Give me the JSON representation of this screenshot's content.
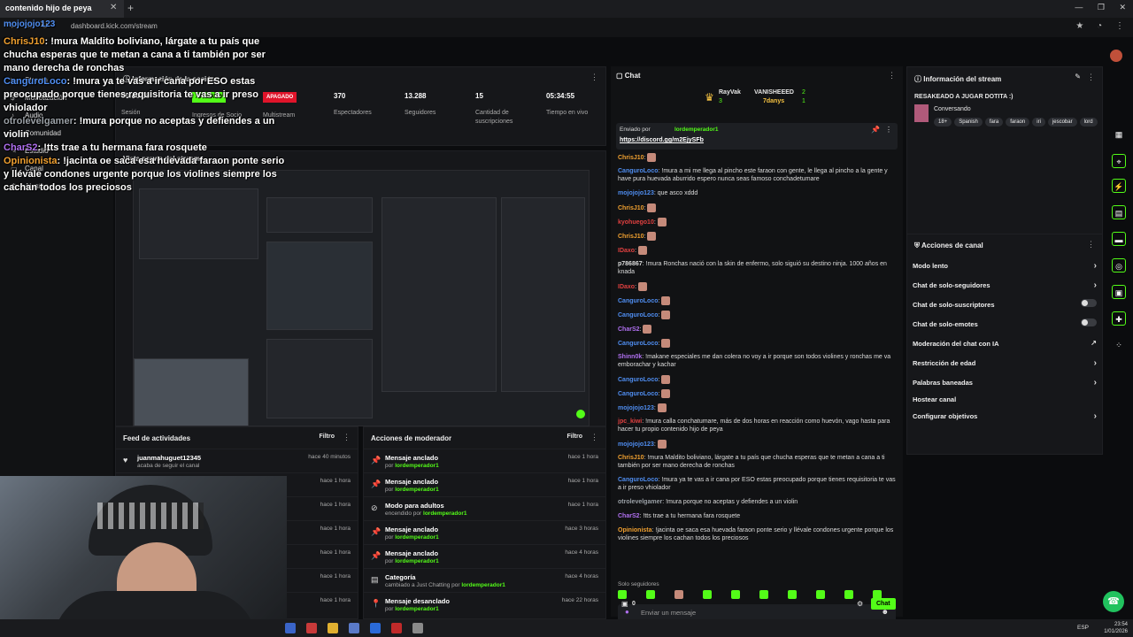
{
  "browser": {
    "tab_title": "contenido hijo de peya",
    "url": "dashboard.kick.com/stream"
  },
  "sidebar": {
    "items": [
      {
        "label": "Stream",
        "icon": "play-icon"
      },
      {
        "label": "Monetización",
        "icon": "coin-icon"
      },
      {
        "label": "Audio",
        "icon": "speaker-icon"
      },
      {
        "label": "Comunidad",
        "icon": "users-icon"
      },
      {
        "label": "Estudio",
        "icon": "brush-icon"
      },
      {
        "label": "Canal",
        "icon": "tv-icon"
      },
      {
        "label": "Ajustes",
        "icon": "gear-icon"
      }
    ]
  },
  "session": {
    "title": "Información de la sesión",
    "stats": [
      {
        "value": "00:00:00",
        "label": "Sesión"
      },
      {
        "value": "APAGADO",
        "label": "Ingresos de Socio"
      },
      {
        "value": "APAGADO",
        "label": "Multistream"
      },
      {
        "value": "370",
        "label": "Espectadores"
      },
      {
        "value": "13.288",
        "label": "Seguidores"
      },
      {
        "value": "15",
        "label": "Cantidad de suscripciones"
      },
      {
        "value": "05:34:55",
        "label": "Tiempo en vivo"
      }
    ]
  },
  "preview": {
    "title": "Vista previa del stream"
  },
  "activity": {
    "title": "Feed de actividades",
    "filter": "Filtro",
    "items": [
      {
        "user": "juanmahuguet12345",
        "desc": "acaba de seguir el canal",
        "time": "hace 40 minutos"
      },
      {
        "user": "",
        "desc": "",
        "time": "hace 1 hora"
      },
      {
        "user": "",
        "desc": "",
        "time": "hace 1 hora"
      },
      {
        "user": "",
        "desc": "",
        "time": "hace 1 hora"
      },
      {
        "user": "",
        "desc": "",
        "time": "hace 1 hora"
      },
      {
        "user": "",
        "desc": "",
        "time": "hace 1 hora"
      },
      {
        "user": "",
        "desc": "",
        "time": "hace 1 hora"
      }
    ]
  },
  "moderator": {
    "title": "Acciones de moderador",
    "filter": "Filtro",
    "items": [
      {
        "icon": "pin-icon",
        "title": "Mensaje anclado",
        "pre": "por",
        "by": "lordemperador1",
        "time": "hace 1 hora"
      },
      {
        "icon": "pin-icon",
        "title": "Mensaje anclado",
        "pre": "por",
        "by": "lordemperador1",
        "time": "hace 1 hora"
      },
      {
        "icon": "adult-icon",
        "title": "Modo para adultos",
        "pre": "encendido por",
        "by": "lordemperador1",
        "time": "hace 1 hora"
      },
      {
        "icon": "pin-icon",
        "title": "Mensaje anclado",
        "pre": "por",
        "by": "lordemperador1",
        "time": "hace 3 horas"
      },
      {
        "icon": "pin-icon",
        "title": "Mensaje anclado",
        "pre": "por",
        "by": "lordemperador1",
        "time": "hace 4 horas"
      },
      {
        "icon": "category-icon",
        "title": "Categoría",
        "pre": "cambiado a Just Chatting por",
        "by": "lordemperador1",
        "time": "hace 4 horas"
      },
      {
        "icon": "unpin-icon",
        "title": "Mensaje desanclado",
        "pre": "por",
        "by": "lordemperador1",
        "time": "hace 22 horas"
      }
    ]
  },
  "chat": {
    "title": "Chat",
    "top": [
      {
        "user": "RayVak",
        "count": "3",
        "color": "#f5c242"
      },
      {
        "user": "VANISHEEED",
        "count": "2",
        "color": "#ffffff"
      },
      {
        "user": "7danys",
        "count": "1",
        "color": "#f5c242"
      }
    ],
    "pinned_by_label": "Enviado por",
    "pinned_by": "lordemperador1",
    "pinned_link": "https://discord.gg/m2EjySFb",
    "messages": [
      {
        "user": "ChrisJ10",
        "color": "#f0a030",
        "text": ""
      },
      {
        "user": "CanguroLoco",
        "color": "#4f8df0",
        "text": "!mura a mi me llega al pincho este faraon con gente, le llega al pincho a la gente y have pura huevada aburrido espero nunca seas famoso conchadetumare"
      },
      {
        "user": "mojojojo123",
        "color": "#4f8df0",
        "text": "que asco xddd"
      },
      {
        "user": "ChrisJ10",
        "color": "#f0a030",
        "text": ""
      },
      {
        "user": "kyohuego10",
        "color": "#e04040",
        "text": ""
      },
      {
        "user": "ChrisJ10",
        "color": "#f0a030",
        "text": ""
      },
      {
        "user": "IDaxo",
        "color": "#e04040",
        "text": ""
      },
      {
        "user": "p786867",
        "color": "#dddddd",
        "text": "!mura Ronchas nació con la skin de enfermo, solo siguió su destino ninja. 1000 años en knada"
      },
      {
        "user": "IDaxo",
        "color": "#e04040",
        "text": ""
      },
      {
        "user": "CanguroLoco",
        "color": "#4f8df0",
        "text": ""
      },
      {
        "user": "CanguroLoco",
        "color": "#4f8df0",
        "text": ""
      },
      {
        "user": "CharS2",
        "color": "#b070f0",
        "text": ""
      },
      {
        "user": "CanguroLoco",
        "color": "#4f8df0",
        "text": ""
      },
      {
        "user": "Shinn0k",
        "color": "#b070f0",
        "text": "!makane especiales me dan colera no voy a ir porque son todos violines y ronchas me va emborachar y kachar"
      },
      {
        "user": "CanguroLoco",
        "color": "#4f8df0",
        "text": ""
      },
      {
        "user": "CanguroLoco",
        "color": "#4f8df0",
        "text": ""
      },
      {
        "user": "mojojojo123",
        "color": "#4f8df0",
        "text": ""
      },
      {
        "user": "jpc_kiwi",
        "color": "#e04040",
        "text": "!mura calla conchatumare, más de dos horas en reacción como huevón, vago hasta para hacer tu propio contenido hijo de peya"
      },
      {
        "user": "mojojojo123",
        "color": "#4f8df0",
        "text": ""
      },
      {
        "user": "ChrisJ10",
        "color": "#f0a030",
        "text": "!mura Maldito boliviano, lárgate a tu país que chucha esperas que te metan a cana a ti también por ser mano derecha de ronchas"
      },
      {
        "user": "CanguroLoco",
        "color": "#4f8df0",
        "text": "!mura ya te vas a ir cana por ESO estas preocupado porque tienes requisitoria te vas a ir preso vhiolador"
      },
      {
        "user": "otrolevelgamer",
        "color": "#9aa0a6",
        "text": "!mura porque no aceptas y defiendes a un violin"
      },
      {
        "user": "CharS2",
        "color": "#b070f0",
        "text": "!tts trae a tu hermana fara rosquete"
      },
      {
        "user": "Opinionista",
        "color": "#f0a030",
        "text": "!jacinta oe saca esa huevada faraon ponte serio y llévale condones urgente porque los violines siempre los cachan todos los preciosos"
      }
    ],
    "followers_only": "Solo seguidores",
    "input_placeholder": "Enviar un mensaje",
    "points": "0",
    "send_label": "Chat"
  },
  "stream_info": {
    "title": "Información del stream",
    "stream_title": "RESAKEADO A JUGAR DOTITA :)",
    "category": "Conversando",
    "tags": [
      "18+",
      "Spanish",
      "fara",
      "faraon",
      "iri",
      "jescobar",
      "lord"
    ]
  },
  "channel_actions": {
    "title": "Acciones de canal",
    "items": [
      {
        "label": "Modo lento",
        "kind": "chevron"
      },
      {
        "label": "Chat de solo-seguidores",
        "kind": "chevron"
      },
      {
        "label": "Chat de solo-suscriptores",
        "kind": "toggle"
      },
      {
        "label": "Chat de solo-emotes",
        "kind": "toggle"
      },
      {
        "label": "Moderación del chat con IA",
        "kind": "external"
      },
      {
        "label": "Restricción de edad",
        "kind": "chevron"
      },
      {
        "label": "Palabras baneadas",
        "kind": "chevron"
      },
      {
        "label": "Hostear canal",
        "kind": "none"
      },
      {
        "label": "Configurar objetivos",
        "kind": "chevron"
      }
    ]
  },
  "overlay": {
    "messages": [
      {
        "user": "ChrisJ10",
        "color": "#f0a030",
        "text": "!mura Maldito boliviano, lárgate a tu país que chucha esperas que te metan a cana a ti también por ser mano derecha de ronchas"
      },
      {
        "user": "CanguroLoco",
        "color": "#4f8df0",
        "text": "!mura ya te vas a ir cana por ESO estas preocupado porque tienes requisitoria te vas a ir preso vhiolador"
      },
      {
        "user": "otrolevelgamer",
        "color": "#9aa0a6",
        "text": "!mura porque no aceptas y defiendes a un violin"
      },
      {
        "user": "CharS2",
        "color": "#b070f0",
        "text": "!tts trae a tu hermana fara rosquete"
      },
      {
        "user": "Opinionista",
        "color": "#f0a030",
        "text": "!jacinta oe saca esa huevada faraon ponte serio y llévale condones urgente porque los violines siempre los cachan todos los preciosos"
      }
    ],
    "handle": "mojojojo123"
  },
  "taskbar": {
    "lang": "ESP",
    "time": "23:54",
    "date": "1/01/2026"
  },
  "colors": {
    "accent": "#53fc18",
    "danger": "#e0142a",
    "panel": "#16171a"
  }
}
